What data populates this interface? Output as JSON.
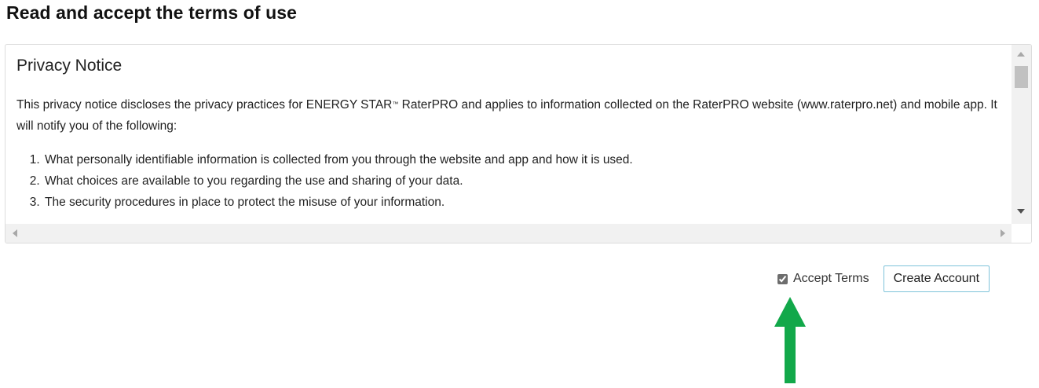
{
  "page": {
    "title": "Read and accept the terms of use"
  },
  "notice": {
    "heading": "Privacy Notice",
    "intro_part1": "This privacy notice discloses the privacy practices for ENERGY STAR",
    "intro_mark": "™",
    "intro_part2": " RaterPRO and applies to information collected on the RaterPRO website (www.raterpro.net) and mobile app. It will notify you of the following:",
    "items": [
      "What personally identifiable information is collected from you through the website and app and how it is used.",
      "What choices are available to you regarding the use and sharing of your data.",
      "The security procedures in place to protect the misuse of your information."
    ]
  },
  "actions": {
    "accept_label": "Accept Terms",
    "accept_checked": true,
    "create_label": "Create Account"
  },
  "annotation": {
    "arrow_color": "#12a84a",
    "icon": "up-arrow-icon"
  },
  "colors": {
    "button_border": "#7ec3da",
    "scrollbar_track": "#f1f1f1",
    "scrollbar_thumb": "#c1c1c1"
  }
}
